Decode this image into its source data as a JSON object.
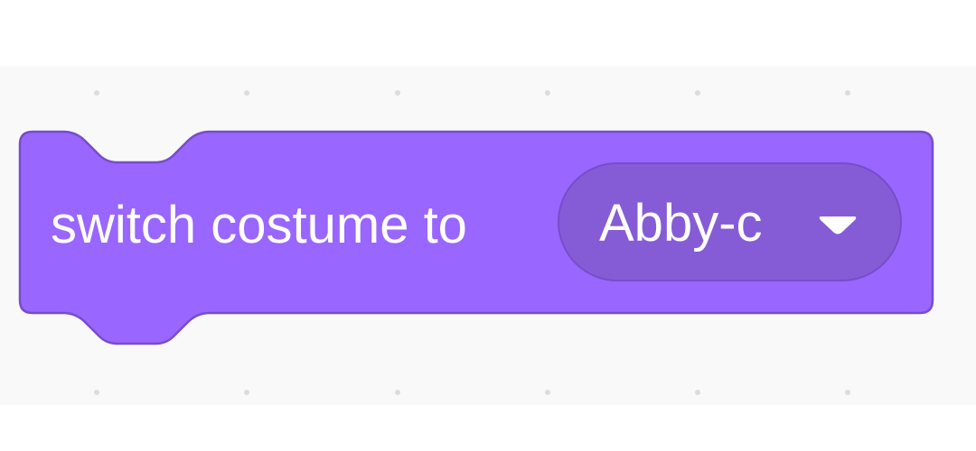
{
  "block": {
    "label": "switch costume to",
    "category": "Looks",
    "color": "#9966ff",
    "border_color": "#774dcb"
  },
  "costume_menu": {
    "selected": "Abby-c",
    "color": "#855cd6",
    "icon": "dropdown-arrow-icon"
  },
  "workspace": {
    "background": "#f9f9f9",
    "grid_dot_color": "#dcdcdc"
  }
}
